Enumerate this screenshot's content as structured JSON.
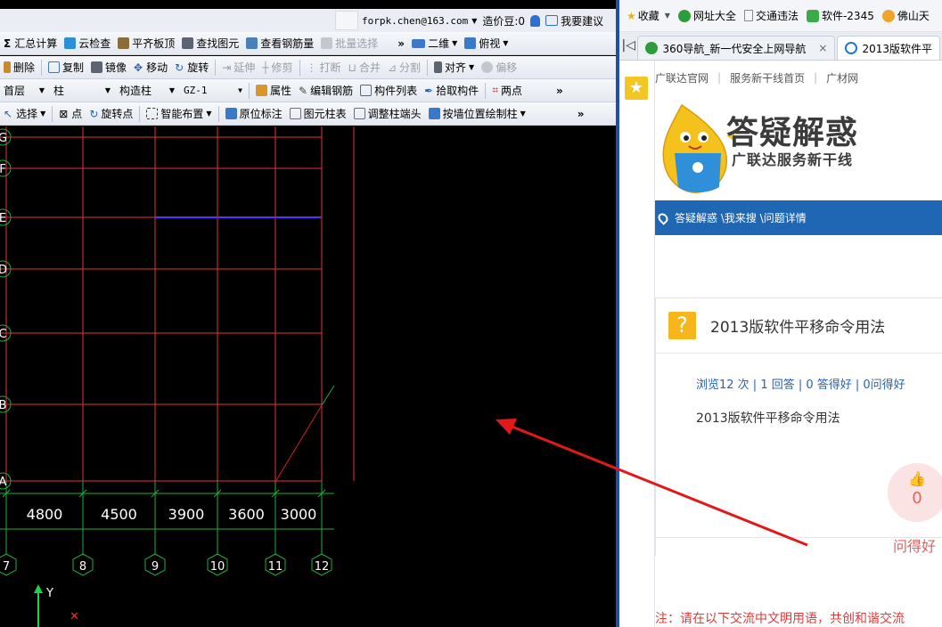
{
  "cad": {
    "account": {
      "email": "forpk.chen@163.com",
      "price_beans": "造价豆:0",
      "suggestion": "我要建议"
    },
    "toolbar1": {
      "summary": "汇总计算",
      "cloud_check": "云检查",
      "flat_slab": "平齐板顶",
      "find_element": "查找图元",
      "view_rebar": "查看钢筋量",
      "batch_select": "批量选择",
      "view_mode": "二维",
      "view_dir": "俯视"
    },
    "toolbar2": {
      "delete": "删除",
      "copy": "复制",
      "mirror": "镜像",
      "move": "移动",
      "rotate": "旋转",
      "extend": "延伸",
      "trim": "修剪",
      "break": "打断",
      "merge": "合并",
      "split": "分割",
      "align": "对齐",
      "offset": "偏移"
    },
    "toolbar3": {
      "floor": "首层",
      "category": "柱",
      "type": "构造柱",
      "name": "GZ-1",
      "properties": "属性",
      "edit_rebar": "编辑钢筋",
      "component_list": "构件列表",
      "pick_component": "拾取构件",
      "two_points": "两点"
    },
    "toolbar4": {
      "select": "选择",
      "point": "点",
      "rotate_point": "旋转点",
      "smart_layout": "智能布置",
      "in_place_label": "原位标注",
      "element_column_table": "图元柱表",
      "adjust_column_end": "调整柱端头",
      "draw_by_wall": "按墙位置绘制柱"
    },
    "grid": {
      "rows": [
        "G",
        "F",
        "E",
        "D",
        "C",
        "B",
        "A"
      ],
      "columns": [
        "7",
        "8",
        "9",
        "10",
        "11",
        "12"
      ],
      "spacings": [
        "4800",
        "4500",
        "3900",
        "3600",
        "3000"
      ],
      "axis_y": "Y",
      "axis_x": "✕"
    }
  },
  "browser": {
    "favorites": [
      "收藏",
      "网址大全",
      "交通违法",
      "软件-2345",
      "佛山天"
    ],
    "tabs": [
      {
        "label": "360导航_新一代安全上网导航",
        "close": "×"
      },
      {
        "label": "2013版软件平"
      }
    ],
    "top_links": [
      "广联达官网",
      "服务新干线首页",
      "广材网"
    ],
    "banner": {
      "title": "答疑解惑",
      "subtitle": "广联达服务新干线"
    },
    "breadcrumb": "答疑解惑 \\我来搜 \\问题详情",
    "question": {
      "title": "2013版软件平移命令用法",
      "stats": "浏览12 次 | 1 回答 | 0 答得好 | 0问得好",
      "body": "2013版软件平移命令用法",
      "likes": "0",
      "good_question": "问得好"
    },
    "notice": "注：请在以下交流中文明用语，共创和谐交流"
  },
  "colors": {
    "grid_red": "#e23333",
    "grid_green": "#1fae3a",
    "selected_wall": "#5a2cff",
    "brand_blue": "#1f67b3",
    "arrow_red": "#e31919"
  }
}
